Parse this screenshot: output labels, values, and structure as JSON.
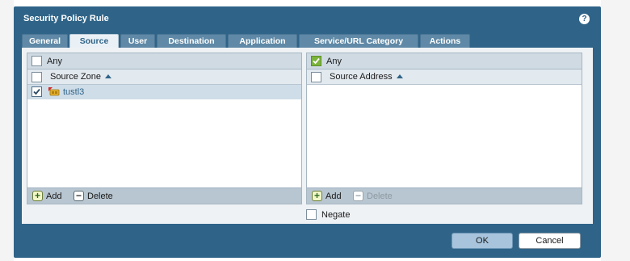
{
  "dialog": {
    "title": "Security Policy Rule",
    "help_glyph": "?"
  },
  "tabs": [
    {
      "label": "General",
      "active": false
    },
    {
      "label": "Source",
      "active": true
    },
    {
      "label": "User",
      "active": false
    },
    {
      "label": "Destination",
      "active": false
    },
    {
      "label": "Application",
      "active": false
    },
    {
      "label": "Service/URL Category",
      "active": false
    },
    {
      "label": "Actions",
      "active": false
    }
  ],
  "source_zone": {
    "any_label": "Any",
    "any_checked": false,
    "column_header": "Source Zone",
    "rows": [
      {
        "label": "tustl3",
        "checked": true
      }
    ],
    "add_label": "Add",
    "delete_label": "Delete"
  },
  "source_address": {
    "any_label": "Any",
    "any_checked": true,
    "column_header": "Source Address",
    "rows": [],
    "add_label": "Add",
    "delete_label": "Delete",
    "delete_disabled": true
  },
  "negate": {
    "label": "Negate",
    "checked": false
  },
  "buttons": {
    "ok_label": "OK",
    "cancel_label": "Cancel"
  },
  "colors": {
    "dialog_header": "#2f6488",
    "tab_inactive": "#5f89a6",
    "any_checked_green": "#7bb33b"
  }
}
